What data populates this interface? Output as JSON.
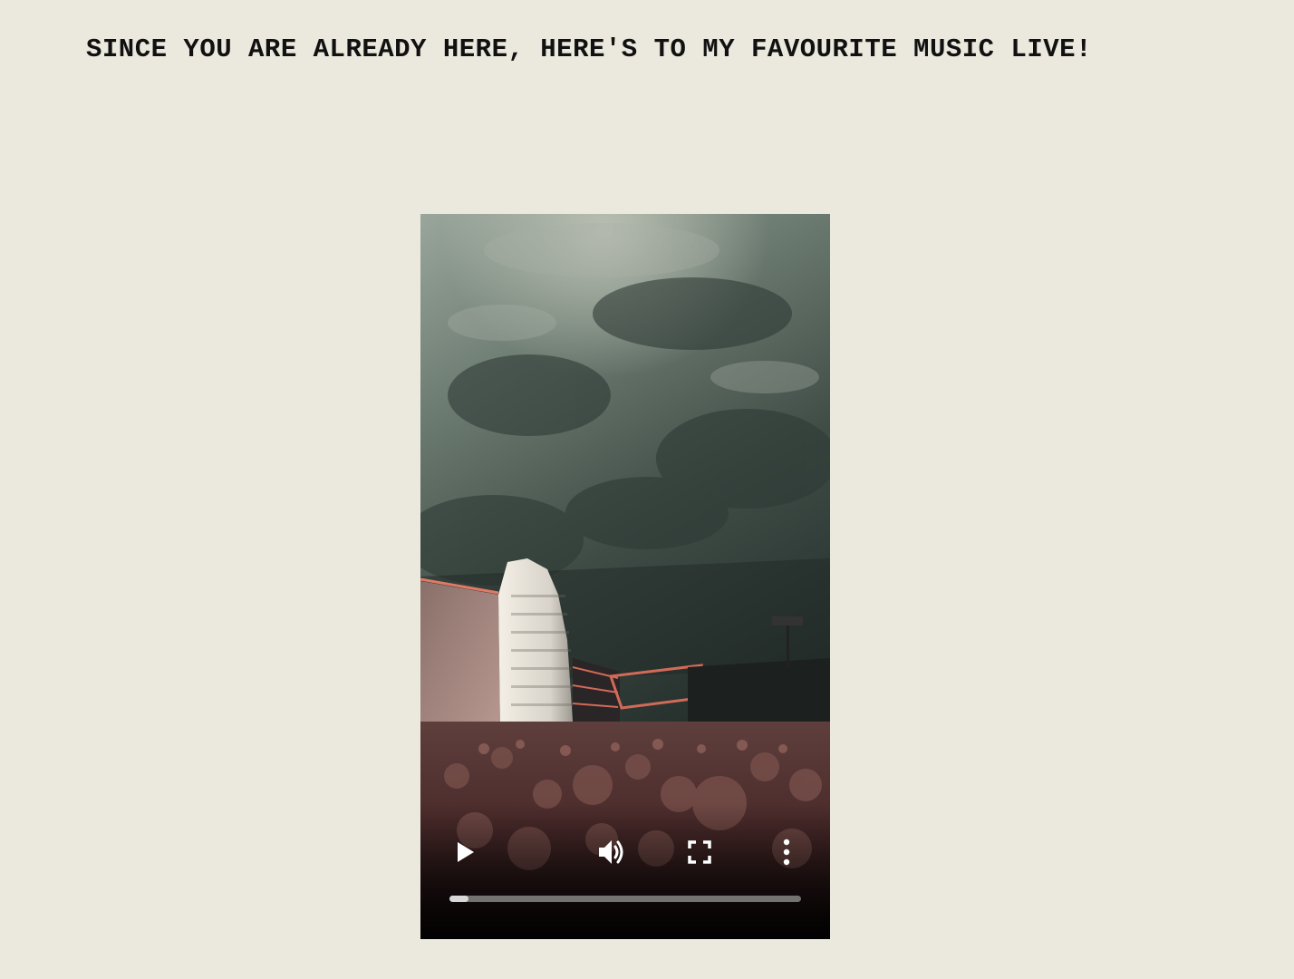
{
  "header": {
    "title": "SINCE YOU ARE ALREADY HERE, HERE'S TO MY FAVOURITE MUSIC LIVE!"
  },
  "video": {
    "progress": 0.055,
    "controls": {
      "play_icon": "play-icon",
      "volume_icon": "volume-icon",
      "fullscreen_icon": "fullscreen-icon",
      "more_icon": "more-vertical-icon"
    }
  }
}
